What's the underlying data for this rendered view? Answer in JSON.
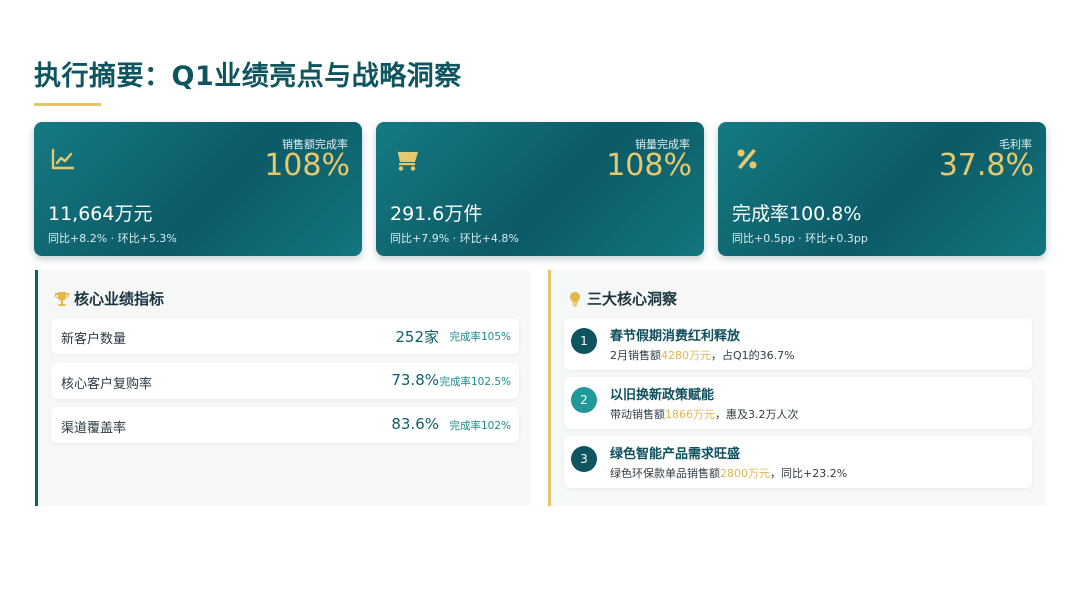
{
  "header": {
    "title": "执行摘要：Q1业绩亮点与战略洞察"
  },
  "kpis": [
    {
      "icon": "line-chart-icon",
      "rate_label": "销售额完成率",
      "rate_value": "108%",
      "main_value": "11,664万元",
      "sub": "同比+8.2% · 环比+5.3%"
    },
    {
      "icon": "shopping-cart-icon",
      "rate_label": "销量完成率",
      "rate_value": "108%",
      "main_value": "291.6万件",
      "sub": "同比+7.9% · 环比+4.8%"
    },
    {
      "icon": "percent-icon",
      "rate_label": "毛利率",
      "rate_value": "37.8%",
      "main_value": "完成率100.8%",
      "sub": "同比+0.5pp · 环比+0.3pp"
    }
  ],
  "metrics_panel": {
    "title": "核心业绩指标",
    "icon": "trophy-icon",
    "rows": [
      {
        "label": "新客户数量",
        "value": "252家",
        "rate": "完成率105%"
      },
      {
        "label": "核心客户复购率",
        "value": "73.8%",
        "rate": "完成率102.5%"
      },
      {
        "label": "渠道覆盖率",
        "value": "83.6%",
        "rate": "完成率102%"
      }
    ]
  },
  "insights_panel": {
    "title": "三大核心洞察",
    "icon": "lightbulb-icon",
    "items": [
      {
        "num": "1",
        "title": "春节假期消费红利释放",
        "desc_pre": "2月销售额",
        "highlight": "4280万元",
        "desc_post": "，占Q1的36.7%",
        "color": "#0f5560"
      },
      {
        "num": "2",
        "title": "以旧换新政策赋能",
        "desc_pre": "带动销售额",
        "highlight": "1866万元",
        "desc_post": "，惠及3.2万人次",
        "color": "#1f9a98"
      },
      {
        "num": "3",
        "title": "绿色智能产品需求旺盛",
        "desc_pre": "绿色环保款单品销售额",
        "highlight": "2800万元",
        "desc_post": "，同比+23.2%",
        "color": "#0f5560"
      }
    ]
  },
  "colors": {
    "accent_gold": "#e4c56b",
    "teal_dark": "#0c5a67",
    "teal": "#157a82"
  }
}
